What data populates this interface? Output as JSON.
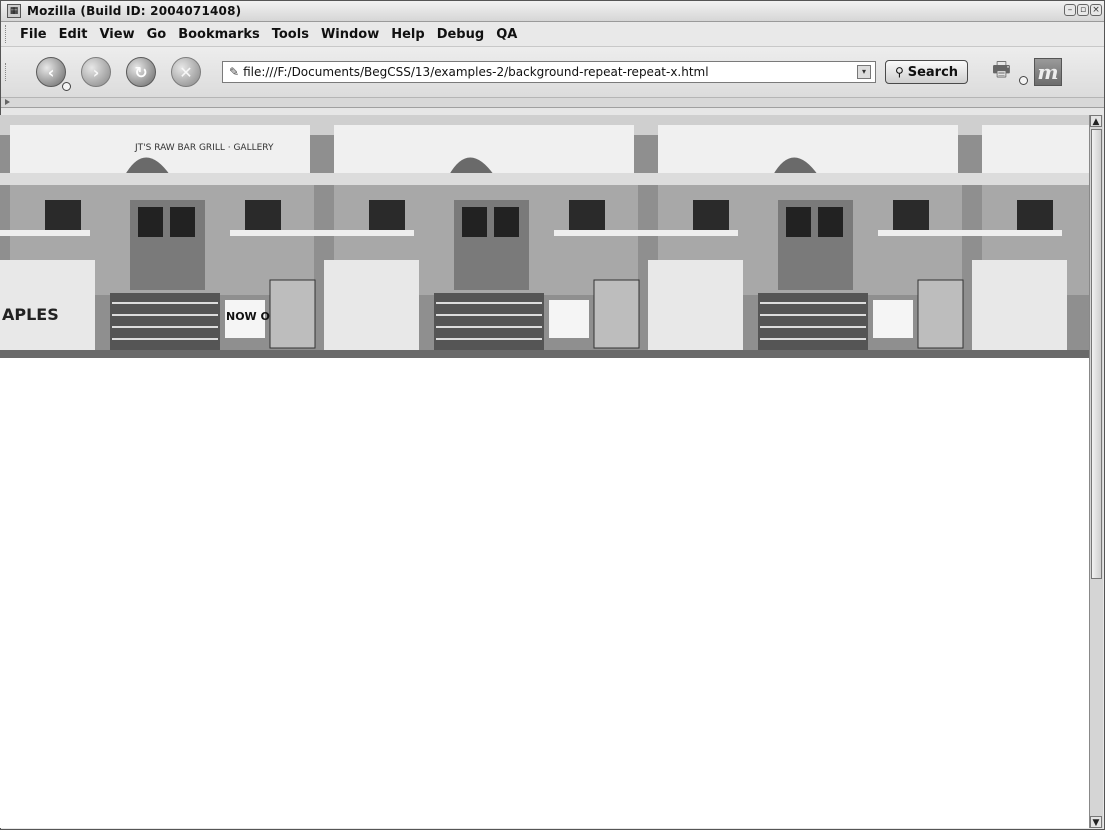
{
  "window": {
    "title": "Mozilla (Build ID: 2004071408)"
  },
  "menubar": {
    "items": [
      "File",
      "Edit",
      "View",
      "Go",
      "Bookmarks",
      "Tools",
      "Window",
      "Help",
      "Debug",
      "QA"
    ]
  },
  "navbar": {
    "back_icon": "back-arrow-icon",
    "forward_icon": "forward-arrow-icon",
    "reload_icon": "reload-icon",
    "stop_icon": "stop-icon",
    "url": "file:///F:/Documents/BegCSS/13/examples-2/background-repeat-repeat-x.html",
    "search_label": "Search",
    "print_icon": "print-icon",
    "logo_icon": "mozilla-logo-icon"
  },
  "content": {
    "background_image": "storefront-photo",
    "repeat": "repeat-x",
    "storefront_signs": {
      "banner": "JT'S RAW BAR GRILL · GALLERY",
      "now_open": "NOW OPEN",
      "aples": "APLES"
    }
  },
  "colors": {
    "chrome": "#e6e6e6",
    "page_bg": "#ffffff"
  }
}
